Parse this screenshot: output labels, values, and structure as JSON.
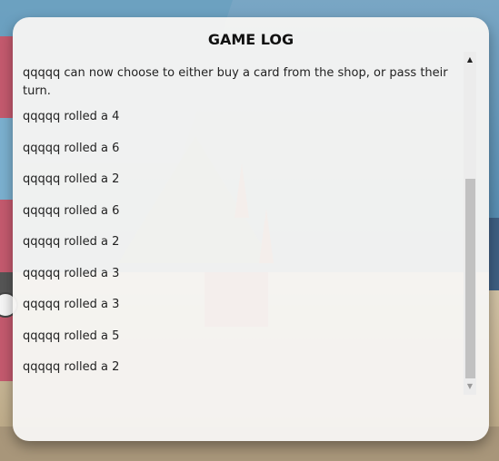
{
  "modal": {
    "title": "GAME LOG"
  },
  "log": [
    "qqqqq can now choose to either buy a card from the shop, or pass their turn.",
    "qqqqq rolled a 4",
    "qqqqq rolled a 6",
    "qqqqq rolled a 2",
    "qqqqq rolled a 6",
    "qqqqq rolled a 2",
    "qqqqq rolled a 3",
    "qqqqq rolled a 3",
    "qqqqq rolled a 5",
    "qqqqq rolled a 2"
  ],
  "scrollbar": {
    "up_icon": "chevron-up-icon",
    "down_icon": "chevron-down-icon",
    "up_glyph": "▲",
    "down_glyph": "▼"
  },
  "colors": {
    "modal_bg": "#f6f5f3",
    "thumb": "#c1c1c1",
    "text": "#222222"
  }
}
